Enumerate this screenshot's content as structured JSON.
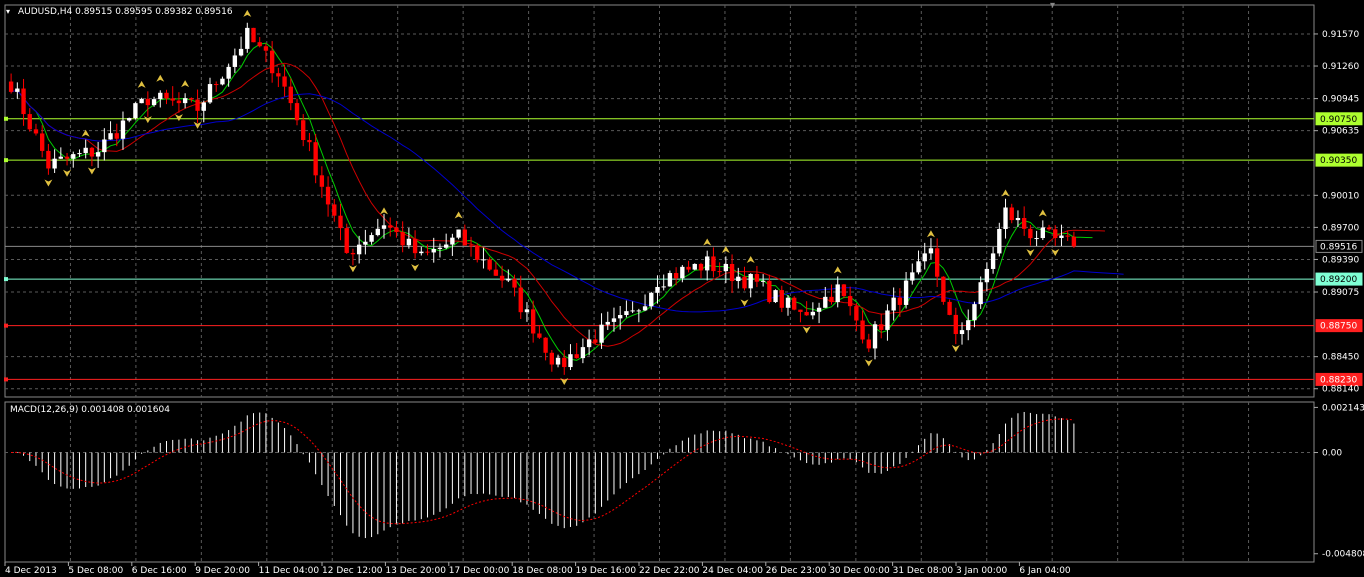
{
  "window": {
    "symbol_header": "AUDUSD,H4  0.89515 0.89595 0.89382 0.89516",
    "indicator_header": "MACD(12,26,9) 0.001408 0.001604"
  },
  "colors": {
    "background": "#000000",
    "grid": "#5a5a5a",
    "bull_candle": "#ffffff",
    "bear_candle": "#ff0000",
    "ma_fast": "#00cc00",
    "ma_mid": "#cc0000",
    "ma_slow": "#0000cc",
    "fractal": "#e0c040",
    "level_green": "#adff2f",
    "level_cyan": "#7fffd4",
    "level_red": "#ff2020",
    "current_price_line": "#8a8a8a",
    "macd_hist": "#ffffff",
    "macd_signal": "#ff0000"
  },
  "price_axis": {
    "ticks": [
      "0.91570",
      "0.91260",
      "0.90945",
      "0.90635",
      "0.90010",
      "0.89700",
      "0.89390",
      "0.89075",
      "0.88450",
      "0.88140"
    ],
    "range": [
      0.8806,
      0.9185
    ]
  },
  "levels": [
    {
      "label": "0.90750",
      "value": 0.9075,
      "style": "green"
    },
    {
      "label": "0.90350",
      "value": 0.9035,
      "style": "green"
    },
    {
      "label": "0.89516",
      "value": 0.89516,
      "style": "current"
    },
    {
      "label": "0.89200",
      "value": 0.892,
      "style": "cyan"
    },
    {
      "label": "0.88750",
      "value": 0.8875,
      "style": "red"
    },
    {
      "label": "0.88230",
      "value": 0.8823,
      "style": "red"
    }
  ],
  "macd_axis": {
    "ticks": [
      "0.002143",
      "0.00",
      "-0.004808"
    ],
    "range": [
      -0.0052,
      0.0024
    ]
  },
  "time_axis": {
    "labels": [
      "4 Dec 2013",
      "5 Dec 08:00",
      "6 Dec 16:00",
      "9 Dec 20:00",
      "11 Dec 04:00",
      "12 Dec 12:00",
      "13 Dec 20:00",
      "17 Dec 00:00",
      "18 Dec 08:00",
      "19 Dec 16:00",
      "22 Dec 22:00",
      "24 Dec 04:00",
      "26 Dec 23:00",
      "30 Dec 00:00",
      "31 Dec 08:00",
      "3 Jan 00:00",
      "6 Jan 04:00"
    ]
  },
  "chart_data": {
    "type": "candlestick",
    "title": "AUDUSD,H4",
    "bars_count": 172,
    "key_prices": [
      {
        "bar": 0,
        "price": 0.911
      },
      {
        "bar": 6,
        "price": 0.903
      },
      {
        "bar": 14,
        "price": 0.9045
      },
      {
        "bar": 22,
        "price": 0.9095
      },
      {
        "bar": 30,
        "price": 0.9085
      },
      {
        "bar": 38,
        "price": 0.9155
      },
      {
        "bar": 43,
        "price": 0.912
      },
      {
        "bar": 48,
        "price": 0.9045
      },
      {
        "bar": 54,
        "price": 0.8945
      },
      {
        "bar": 60,
        "price": 0.8975
      },
      {
        "bar": 66,
        "price": 0.894
      },
      {
        "bar": 72,
        "price": 0.896
      },
      {
        "bar": 80,
        "price": 0.8915
      },
      {
        "bar": 88,
        "price": 0.8835
      },
      {
        "bar": 94,
        "price": 0.8865
      },
      {
        "bar": 100,
        "price": 0.8885
      },
      {
        "bar": 104,
        "price": 0.892
      },
      {
        "bar": 112,
        "price": 0.8935
      },
      {
        "bar": 120,
        "price": 0.8915
      },
      {
        "bar": 127,
        "price": 0.8885
      },
      {
        "bar": 133,
        "price": 0.891
      },
      {
        "bar": 138,
        "price": 0.886
      },
      {
        "bar": 142,
        "price": 0.8895
      },
      {
        "bar": 148,
        "price": 0.8945
      },
      {
        "bar": 152,
        "price": 0.886
      },
      {
        "bar": 156,
        "price": 0.891
      },
      {
        "bar": 160,
        "price": 0.8985
      },
      {
        "bar": 164,
        "price": 0.8965
      },
      {
        "bar": 171,
        "price": 0.89516
      }
    ],
    "last_price": 0.89516
  }
}
